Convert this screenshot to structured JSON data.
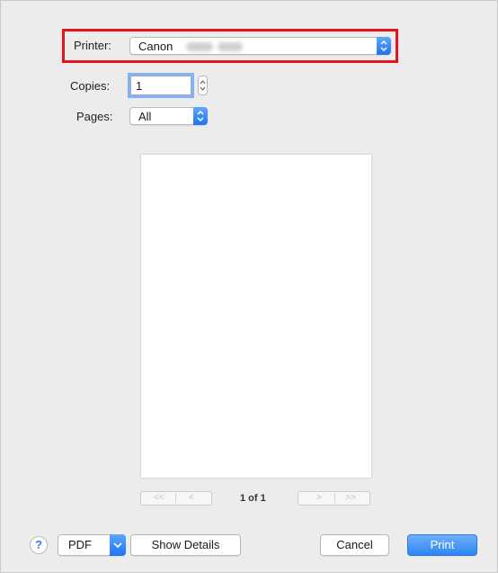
{
  "printer": {
    "label": "Printer:",
    "value": "Canon"
  },
  "copies": {
    "label": "Copies:",
    "value": "1"
  },
  "pages": {
    "label": "Pages:",
    "value": "All"
  },
  "preview_nav": {
    "first": "<<",
    "prev": "<",
    "page_indicator": "1 of 1",
    "next": ">",
    "last": ">>"
  },
  "footer": {
    "help": "?",
    "pdf": "PDF",
    "show_details": "Show Details",
    "cancel": "Cancel",
    "print": "Print"
  },
  "colors": {
    "accent": "#2f84f3",
    "highlight_border": "#e3131c",
    "background": "#ececec"
  }
}
